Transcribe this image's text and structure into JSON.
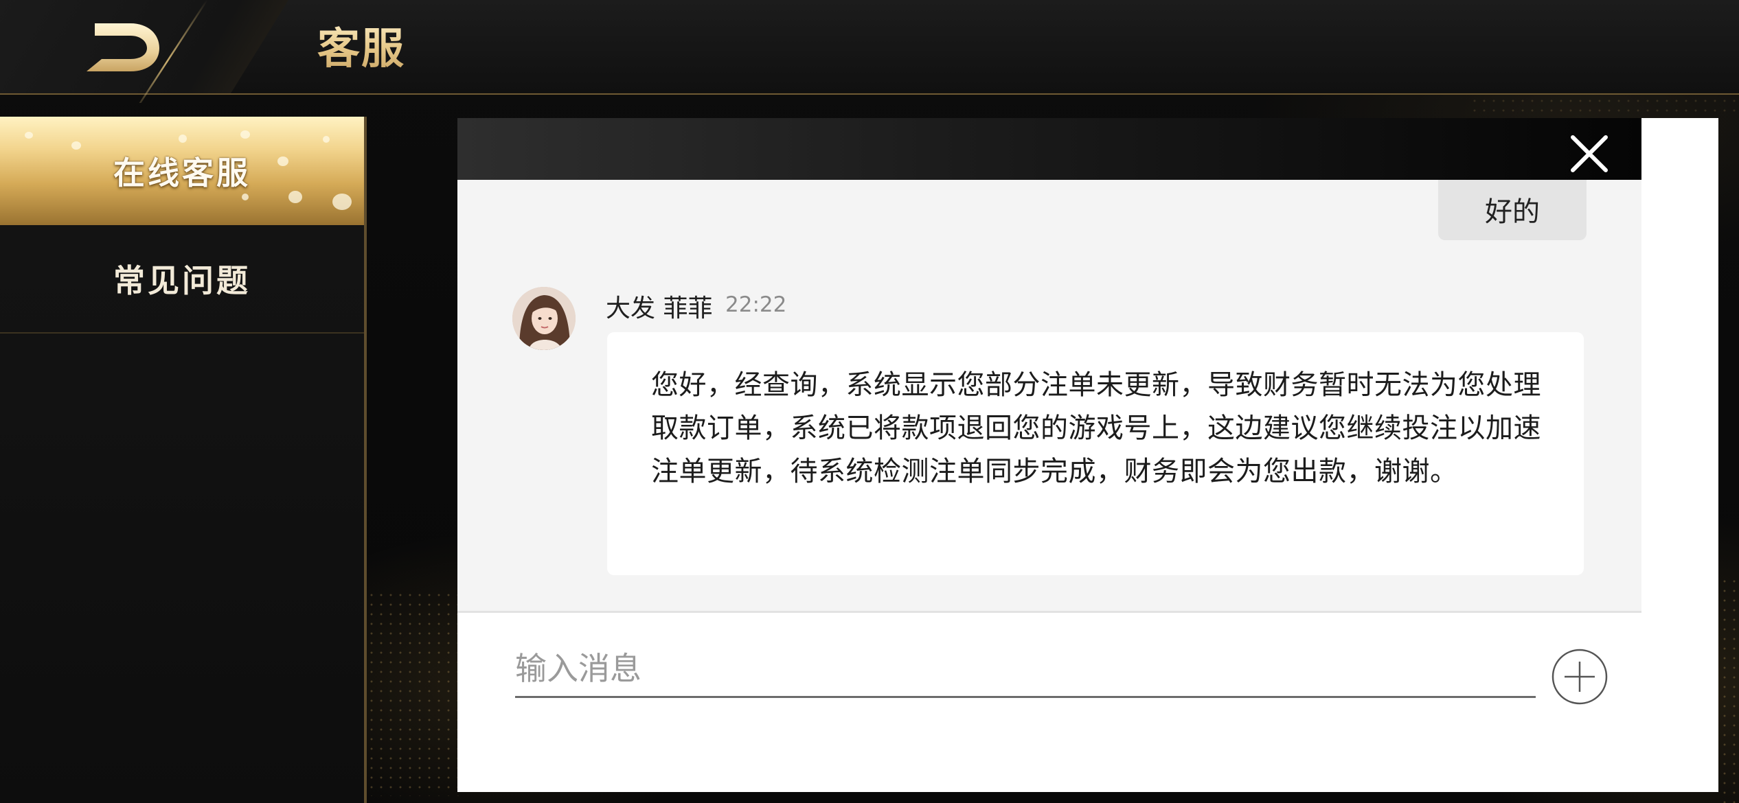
{
  "header": {
    "title": "客服",
    "back_icon": "back-arrow-icon"
  },
  "sidebar": {
    "items": [
      {
        "label": "在线客服",
        "active": true
      },
      {
        "label": "常见问题",
        "active": false
      }
    ]
  },
  "chat": {
    "close_icon": "close-icon",
    "user_message": "好的",
    "agent": {
      "name": "大发 菲菲",
      "time": "22:22",
      "message": "您好，经查询，系统显示您部分注单未更新，导致财务暂时无法为您处理取款订单，系统已将款项退回您的游戏号上，这边建议您继续投注以加速注单更新，待系统检测注单同步完成，财务即会为您出款，谢谢。"
    },
    "input": {
      "placeholder": "输入消息",
      "value": ""
    },
    "attach_icon": "plus-circle-icon"
  },
  "colors": {
    "accent_gold": "#e7c98a",
    "background": "#0a0a0a",
    "chat_background": "#f4f4f4"
  }
}
